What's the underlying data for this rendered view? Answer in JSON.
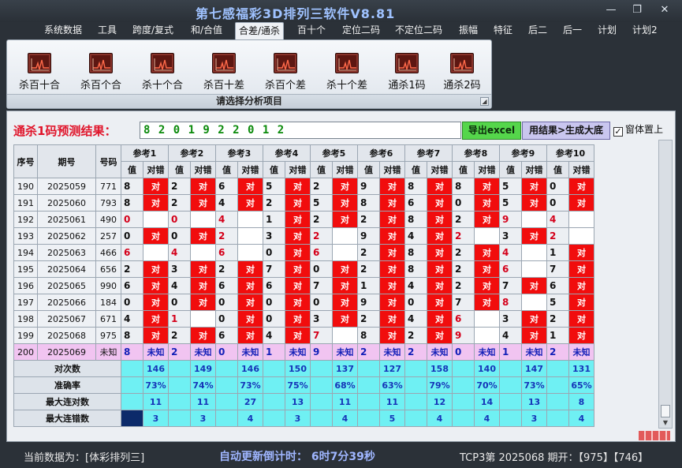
{
  "window": {
    "title": "第七感福彩3D排列三软件V8.81",
    "minimize_glyph": "—",
    "restore_glyph": "❐",
    "close_glyph": "✕"
  },
  "menu": [
    {
      "label": "系统数据"
    },
    {
      "label": "工具"
    },
    {
      "label": "跨度/复式"
    },
    {
      "label": "和/合值"
    },
    {
      "label": "合差/通杀",
      "active": true
    },
    {
      "label": "百十个"
    },
    {
      "label": "定位二码"
    },
    {
      "label": "不定位二码"
    },
    {
      "label": "振幅"
    },
    {
      "label": "特征"
    },
    {
      "label": "后二"
    },
    {
      "label": "后一"
    },
    {
      "label": "计划"
    },
    {
      "label": "计划2"
    }
  ],
  "ribbon": {
    "caption": "请选择分析项目",
    "buttons": [
      {
        "label": "杀百十合",
        "icon": "chart-icon"
      },
      {
        "label": "杀百个合",
        "icon": "chart-icon"
      },
      {
        "label": "杀十个合",
        "icon": "chart-icon"
      },
      {
        "label": "杀百十差",
        "icon": "chart-icon"
      },
      {
        "label": "杀百个差",
        "icon": "chart-icon"
      },
      {
        "label": "杀十个差",
        "icon": "chart-icon"
      },
      {
        "label": "通杀1码",
        "icon": "chart-icon"
      },
      {
        "label": "通杀2码",
        "icon": "chart-icon"
      }
    ]
  },
  "prediction": {
    "label": "通杀1码预测结果：",
    "value": "8 2 0 1 9 2 2 0 1 2"
  },
  "buttons": {
    "export": "导出excel",
    "generate": "用结果>生成大底",
    "topmost_label": "窗体置上",
    "topmost_checked": true
  },
  "grid": {
    "headers": {
      "seq": "序号",
      "period": "期号",
      "code": "号码",
      "value": "值",
      "result": "对错"
    },
    "refs": [
      "参考1",
      "参考2",
      "参考3",
      "参考4",
      "参考5",
      "参考6",
      "参考7",
      "参考8",
      "参考9",
      "参考10"
    ],
    "hit_text": "对",
    "rows": [
      {
        "seq": "190",
        "period": "2025059",
        "code": "771",
        "vals": [
          "8",
          "2",
          "6",
          "5",
          "2",
          "9",
          "8",
          "8",
          "5",
          "0"
        ],
        "hits": [
          1,
          1,
          1,
          1,
          1,
          1,
          1,
          1,
          1,
          1
        ]
      },
      {
        "seq": "191",
        "period": "2025060",
        "code": "793",
        "vals": [
          "8",
          "2",
          "4",
          "2",
          "5",
          "8",
          "6",
          "0",
          "5",
          "0"
        ],
        "hits": [
          1,
          1,
          1,
          1,
          1,
          1,
          1,
          1,
          1,
          1
        ]
      },
      {
        "seq": "192",
        "period": "2025061",
        "code": "490",
        "vals": [
          "0",
          "0",
          "4",
          "1",
          "2",
          "2",
          "8",
          "2",
          "9",
          "4"
        ],
        "hits": [
          0,
          0,
          0,
          1,
          1,
          1,
          1,
          1,
          0,
          0
        ]
      },
      {
        "seq": "193",
        "period": "2025062",
        "code": "257",
        "vals": [
          "0",
          "0",
          "2",
          "3",
          "2",
          "9",
          "4",
          "2",
          "3",
          "2"
        ],
        "hits": [
          1,
          1,
          0,
          1,
          0,
          1,
          1,
          0,
          1,
          0
        ]
      },
      {
        "seq": "194",
        "period": "2025063",
        "code": "466",
        "vals": [
          "6",
          "4",
          "6",
          "0",
          "6",
          "2",
          "8",
          "2",
          "4",
          "1"
        ],
        "hits": [
          0,
          0,
          0,
          1,
          0,
          1,
          1,
          1,
          0,
          1
        ]
      },
      {
        "seq": "195",
        "period": "2025064",
        "code": "656",
        "vals": [
          "2",
          "3",
          "2",
          "7",
          "0",
          "2",
          "8",
          "2",
          "6",
          "7"
        ],
        "hits": [
          1,
          1,
          1,
          1,
          1,
          1,
          1,
          1,
          0,
          1
        ]
      },
      {
        "seq": "196",
        "period": "2025065",
        "code": "990",
        "vals": [
          "6",
          "4",
          "6",
          "6",
          "7",
          "1",
          "4",
          "2",
          "7",
          "6"
        ],
        "hits": [
          1,
          1,
          1,
          1,
          1,
          1,
          1,
          1,
          1,
          1
        ]
      },
      {
        "seq": "197",
        "period": "2025066",
        "code": "184",
        "vals": [
          "0",
          "0",
          "0",
          "0",
          "0",
          "9",
          "0",
          "7",
          "8",
          "5"
        ],
        "hits": [
          1,
          1,
          1,
          1,
          1,
          1,
          1,
          1,
          0,
          1
        ]
      },
      {
        "seq": "198",
        "period": "2025067",
        "code": "671",
        "vals": [
          "4",
          "1",
          "0",
          "0",
          "3",
          "2",
          "4",
          "6",
          "3",
          "2"
        ],
        "hits": [
          1,
          0,
          1,
          1,
          1,
          1,
          1,
          0,
          1,
          1
        ]
      },
      {
        "seq": "199",
        "period": "2025068",
        "code": "975",
        "vals": [
          "8",
          "2",
          "6",
          "4",
          "7",
          "8",
          "2",
          "9",
          "4",
          "1"
        ],
        "hits": [
          1,
          1,
          1,
          1,
          0,
          1,
          1,
          0,
          1,
          1
        ]
      }
    ],
    "red_values": [
      [
        0,
        0,
        0,
        0,
        0,
        0,
        0,
        0,
        0,
        0
      ],
      [
        0,
        0,
        0,
        0,
        0,
        0,
        0,
        0,
        0,
        0
      ],
      [
        1,
        1,
        1,
        0,
        0,
        0,
        0,
        0,
        1,
        1
      ],
      [
        0,
        0,
        1,
        0,
        1,
        0,
        0,
        1,
        0,
        1
      ],
      [
        1,
        1,
        1,
        0,
        1,
        0,
        0,
        0,
        1,
        0
      ],
      [
        0,
        0,
        0,
        0,
        0,
        0,
        0,
        0,
        1,
        0
      ],
      [
        0,
        0,
        0,
        0,
        0,
        0,
        0,
        0,
        0,
        0
      ],
      [
        0,
        0,
        0,
        0,
        0,
        0,
        0,
        0,
        1,
        0
      ],
      [
        0,
        1,
        0,
        0,
        0,
        0,
        0,
        1,
        0,
        0
      ],
      [
        0,
        0,
        0,
        0,
        1,
        0,
        0,
        1,
        0,
        0
      ]
    ],
    "pending": {
      "seq": "200",
      "period": "2025069",
      "code": "未知",
      "vals": [
        "8",
        "2",
        "0",
        "1",
        "9",
        "2",
        "2",
        "0",
        "1",
        "2"
      ],
      "text": "未知"
    },
    "stats": [
      {
        "label": "对次数",
        "values": [
          "146",
          "149",
          "146",
          "150",
          "137",
          "127",
          "158",
          "140",
          "147",
          "131"
        ]
      },
      {
        "label": "准确率",
        "values": [
          "73%",
          "74%",
          "73%",
          "75%",
          "68%",
          "63%",
          "79%",
          "70%",
          "73%",
          "65%"
        ]
      },
      {
        "label": "最大连对数",
        "values": [
          "11",
          "11",
          "27",
          "13",
          "11",
          "11",
          "12",
          "14",
          "13",
          "8"
        ]
      },
      {
        "label": "最大连错数",
        "values": [
          "3",
          "3",
          "4",
          "3",
          "4",
          "5",
          "4",
          "4",
          "3",
          "4"
        ]
      }
    ]
  },
  "status": {
    "data_source": "当前数据为：[体彩排列三]",
    "countdown": "自动更新倒计时： 6时7分39秒",
    "latest": "TCP3第 2025068 期开：【975】【746】"
  }
}
